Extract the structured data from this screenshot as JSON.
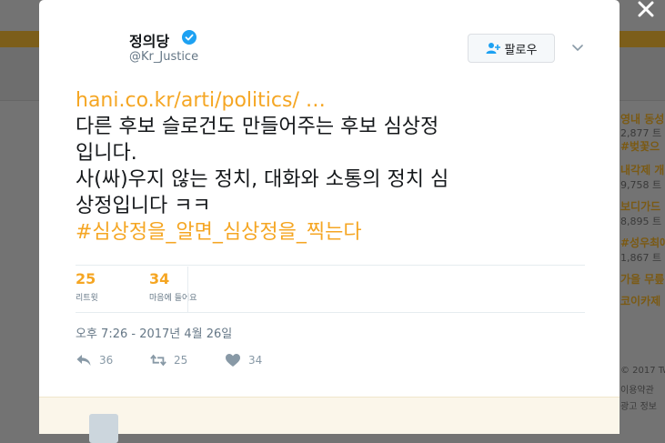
{
  "tweet": {
    "display_name": "정의당",
    "handle": "@Kr_Justice",
    "follow_label": "팔로우",
    "link_text": "hani.co.kr/arti/politics/ …",
    "lines": [
      "다른 후보 슬로건도 만들어주는 후보 심상정",
      "입니다.",
      "사(싸)우지 않는 정치, 대화와 소통의 정치 심",
      "상정입니다 ㅋㅋ"
    ],
    "hashtag": "#심상정을_알면_심상정을_찍는다",
    "retweets": {
      "count": "25",
      "label": "리트윗"
    },
    "likes": {
      "count": "34",
      "label": "마음에 들어요"
    },
    "timestamp": "오후 7:26 - 2017년 4월 26일",
    "actions": {
      "reply_count": "36",
      "retweet_count": "25",
      "like_count": "34"
    }
  },
  "background": {
    "trends": [
      {
        "title": "영내 동성",
        "count": "2,877 트"
      },
      {
        "title": "#벚꽃으",
        "count": ""
      },
      {
        "title": "내각제 개",
        "count": "9,758 트"
      },
      {
        "title": "보디가드",
        "count": "8,895 트"
      },
      {
        "title": "#성우최애",
        "count": "1,867 트"
      },
      {
        "title": "가을 무릎",
        "count": ""
      },
      {
        "title": "코이카제",
        "count": ""
      }
    ],
    "footer": [
      "© 2017 Tw",
      "이용약관",
      "광고 정보"
    ]
  },
  "colors": {
    "accent": "#f5a623",
    "text": "#14171a",
    "muted": "#657786",
    "verified": "#1da1f2"
  },
  "icons": {
    "close": "close-icon",
    "verified": "verified-badge-icon",
    "follow": "follow-user-icon",
    "chevron": "chevron-down-icon",
    "reply": "reply-icon",
    "retweet": "retweet-icon",
    "like": "heart-icon"
  }
}
